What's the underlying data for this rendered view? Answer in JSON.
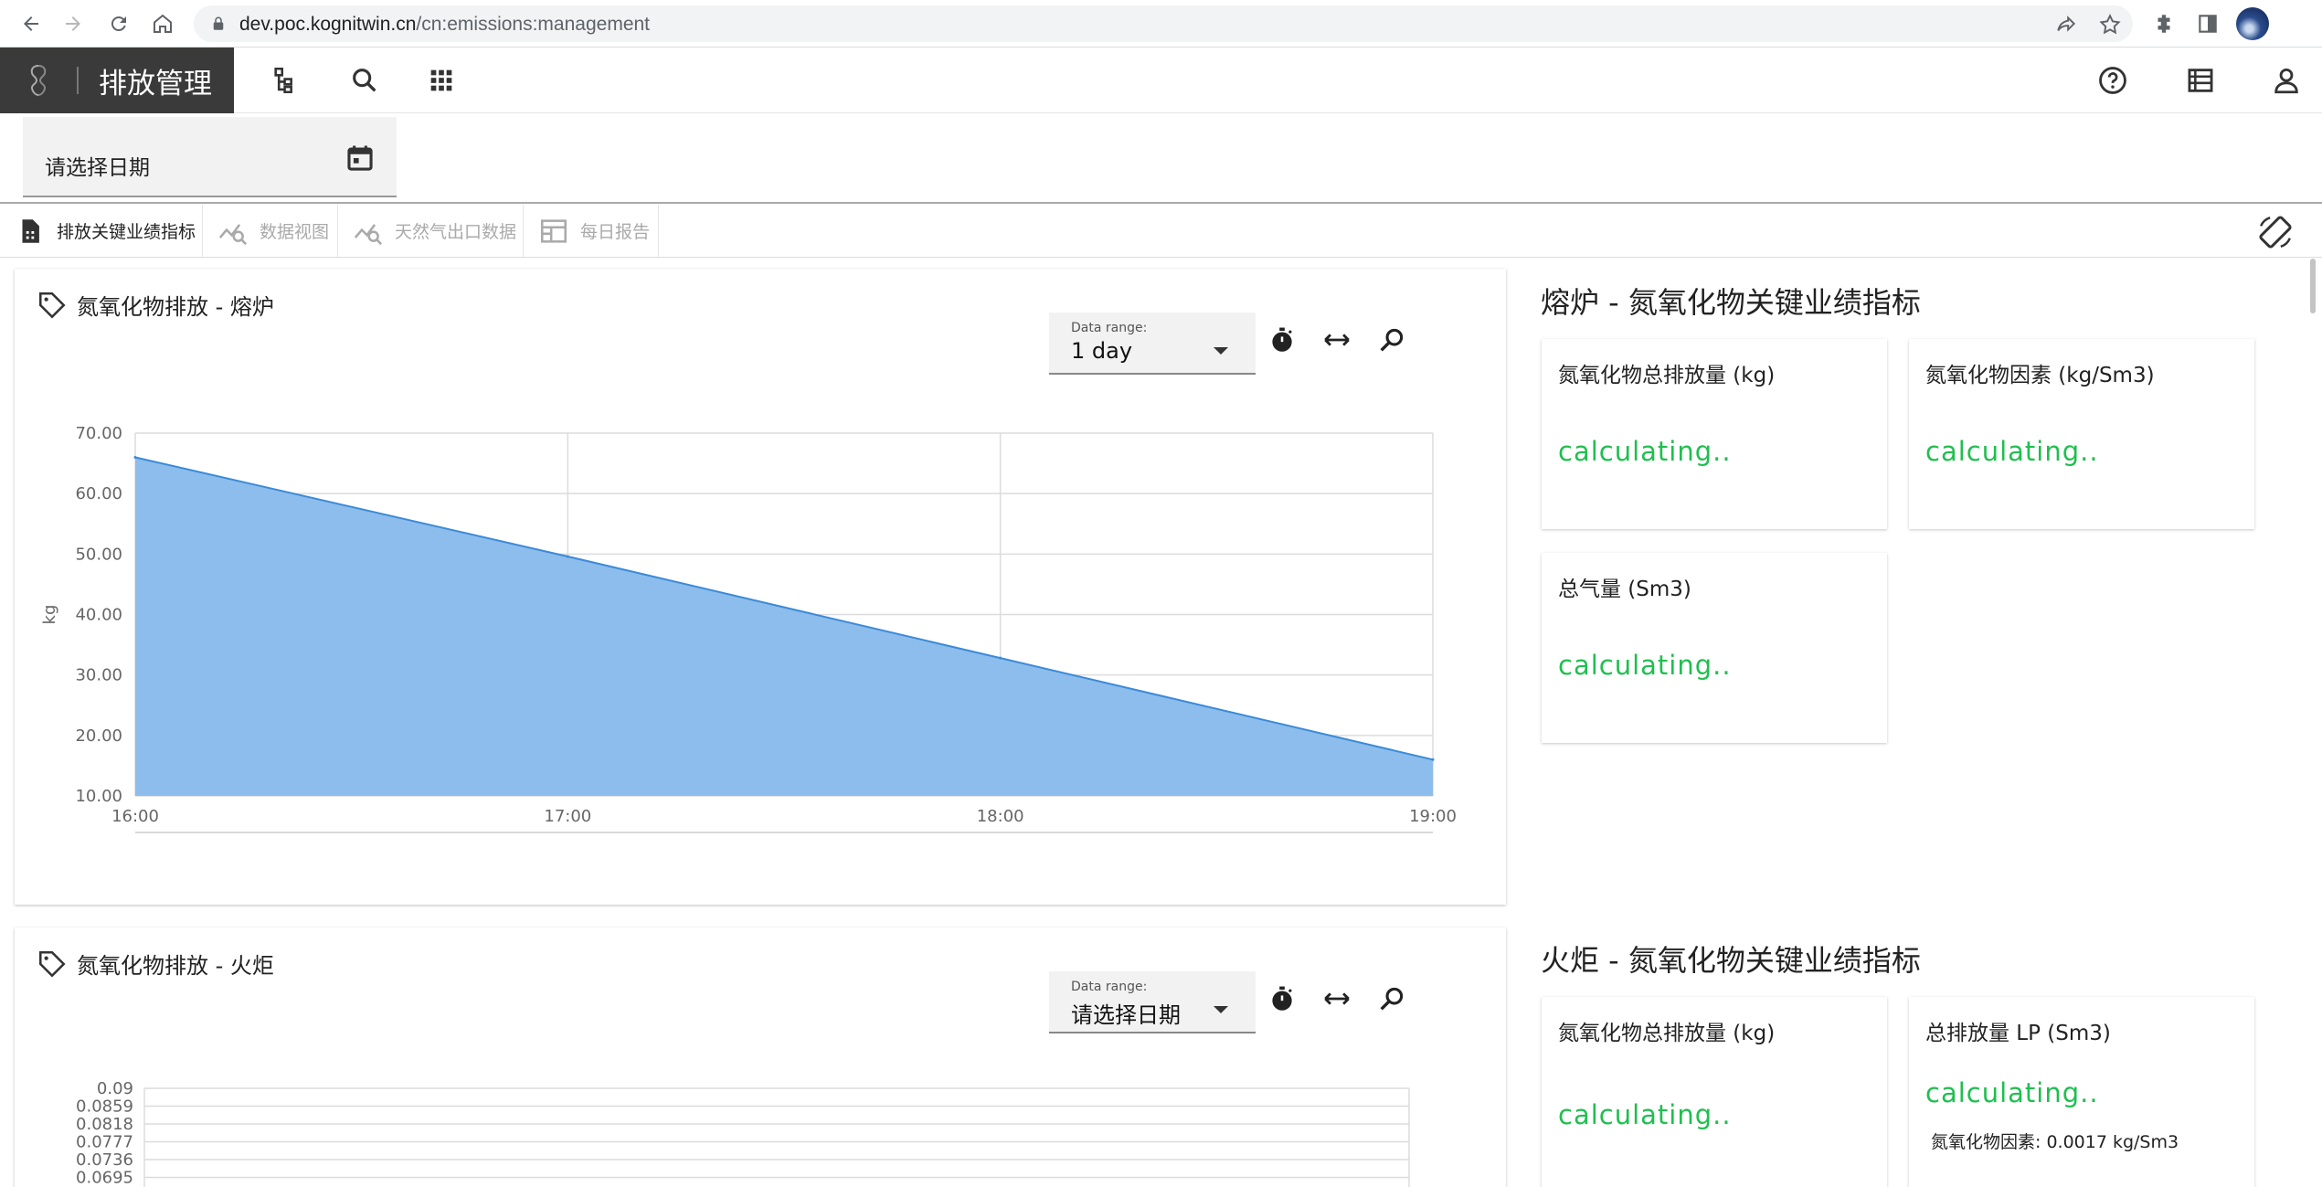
{
  "browser": {
    "url_host": "dev.poc.kognitwin.cn",
    "url_path": "/cn:emissions:management"
  },
  "header": {
    "app_title": "排放管理",
    "icons": [
      "hierarchy-icon",
      "search-icon",
      "apps-grid-icon",
      "help-icon",
      "list-view-icon",
      "account-icon"
    ]
  },
  "date_picker": {
    "placeholder": "请选择日期"
  },
  "tabs": [
    {
      "label": "排放关键业绩指标",
      "active": true
    },
    {
      "label": "数据视图",
      "active": false
    },
    {
      "label": "天然气出口数据",
      "active": false
    },
    {
      "label": "每日报告",
      "active": false
    }
  ],
  "panels": [
    {
      "title": "氮氧化物排放 - 熔炉",
      "range_label": "Data range:",
      "range_value": "1 day"
    },
    {
      "title": "氮氧化物排放 - 火炬",
      "range_label": "Data range:",
      "range_value": "请选择日期"
    }
  ],
  "kpi_sections": [
    {
      "heading": "熔炉 - 氮氧化物关键业绩指标",
      "cards": [
        {
          "title": "氮氧化物总排放量 (kg)",
          "value": "calculating.."
        },
        {
          "title": "氮氧化物因素 (kg/Sm3)",
          "value": "calculating.."
        },
        {
          "title": "总气量 (Sm3)",
          "value": "calculating.."
        }
      ]
    },
    {
      "heading": "火炬 - 氮氧化物关键业绩指标",
      "cards": [
        {
          "title": "氮氧化物总排放量 (kg)",
          "value": "calculating.."
        },
        {
          "title": "总排放量 LP (Sm3)",
          "value": "calculating..",
          "sub": "氮氧化物因素: 0.0017 kg/Sm3"
        }
      ]
    }
  ],
  "colors": {
    "accent_green": "#1fbf4f",
    "area_fill": "#8bbcec",
    "area_line": "#3c8ad6"
  },
  "chart_data": [
    {
      "type": "area",
      "x": [
        "16:00",
        "17:00",
        "18:00",
        "19:00"
      ],
      "values": [
        66,
        49.6,
        32.8,
        16
      ],
      "ylabel": "kg",
      "yticks": [
        "70.00",
        "60.00",
        "50.00",
        "40.00",
        "30.00",
        "20.00",
        "10.00"
      ],
      "ylim": [
        10,
        70
      ],
      "grid": true
    },
    {
      "type": "line",
      "yticks": [
        "0.09",
        "0.0859",
        "0.0818",
        "0.0777",
        "0.0736",
        "0.0695"
      ],
      "ylim": [
        0.0695,
        0.09
      ],
      "grid": true
    }
  ]
}
